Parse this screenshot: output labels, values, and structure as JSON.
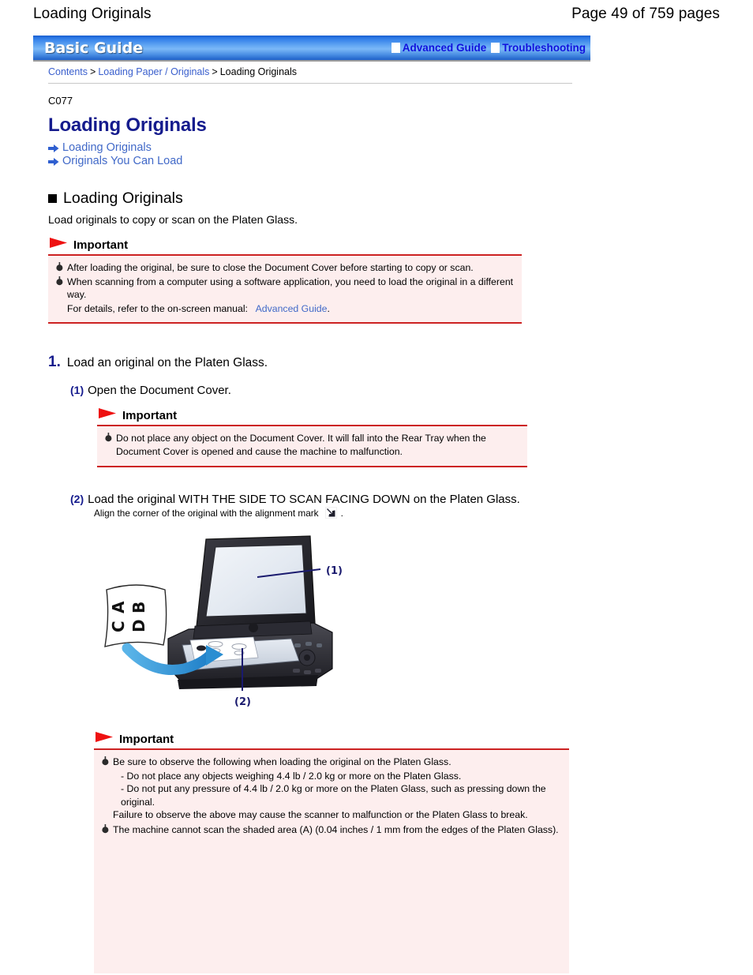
{
  "page_header": {
    "doc_title": "Loading Originals",
    "page_count": "Page 49 of 759 pages"
  },
  "banner": {
    "brand": "Basic Guide",
    "links": [
      {
        "label": "Advanced Guide",
        "icon": "white-square-marker"
      },
      {
        "label": "Troubleshooting",
        "icon": "white-square-marker"
      }
    ]
  },
  "breadcrumb": {
    "items": [
      {
        "label": "Contents",
        "is_link": true
      },
      {
        "label": "Loading Paper / Originals",
        "is_link": true
      },
      {
        "label": "Loading Originals",
        "is_link": false
      }
    ],
    "separator": ">"
  },
  "content": {
    "doc_id": "C077",
    "title": "Loading Originals",
    "jump_links": [
      {
        "label": "Loading Originals",
        "icon": "blue-arrow-icon"
      },
      {
        "label": "Originals You Can Load",
        "icon": "blue-arrow-icon"
      }
    ],
    "section": {
      "title": "Loading Originals",
      "lead": "Load originals to copy or scan on the Platen Glass."
    },
    "important_1": {
      "label": "Important",
      "items": [
        "After loading the original, be sure to close the Document Cover before starting to copy or scan.",
        "When scanning from a computer using a software application, you need to load the original in a different way."
      ],
      "detail_prefix": "For details, refer to the on-screen manual:",
      "detail_link": "Advanced Guide",
      "detail_suffix": "."
    },
    "step_1": {
      "number": "1.",
      "text": "Load an original on the Platen Glass."
    },
    "substep_1": {
      "number": "(1)",
      "text": "Open the Document Cover."
    },
    "important_2": {
      "label": "Important",
      "items": [
        "Do not place any object on the Document Cover. It will fall into the Rear Tray when the Document Cover is opened and cause the machine to malfunction."
      ]
    },
    "substep_2": {
      "number": "(2)",
      "text": "Load the original WITH THE SIDE TO SCAN FACING DOWN on the Platen Glass.",
      "align_note_prefix": "Align the corner of the original with the alignment mark",
      "align_note_suffix": ".",
      "align_icon": "alignment-mark-icon"
    },
    "illustration": {
      "name": "platen-glass-loading-diagram",
      "paper_letters": [
        "A",
        "B",
        "C",
        "D"
      ],
      "callouts": [
        {
          "label": "(1)"
        },
        {
          "label": "(2)"
        }
      ]
    },
    "important_3": {
      "label": "Important",
      "items": [
        {
          "main": "Be sure to observe the following when loading the original on the Platen Glass.",
          "subs": [
            "- Do not place any objects weighing 4.4 lb / 2.0 kg or more on the Platen Glass.",
            "- Do not put any pressure of 4.4 lb / 2.0 kg or more on the Platen Glass, such as pressing down the original.",
            "Failure to observe the above may cause the scanner to malfunction or the Platen Glass to break."
          ]
        },
        {
          "main": "The machine cannot scan the shaded area (A) (0.04 inches / 1 mm from the edges of the Platen Glass).",
          "subs": []
        }
      ]
    }
  },
  "colors": {
    "title_navy": "#151b8d",
    "link_blue": "#4169c8",
    "banner_link_blue": "#1111dd",
    "important_red": "#cc2222",
    "important_bg": "#fdeeee",
    "banner_blue": "#2f7ce8"
  }
}
